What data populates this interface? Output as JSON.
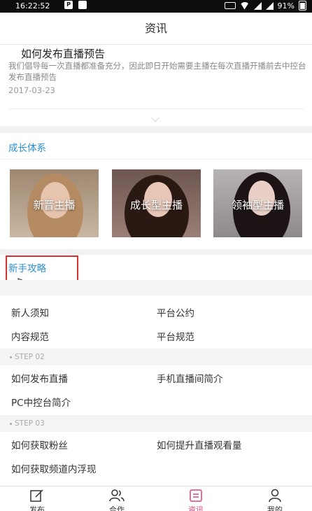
{
  "status_bar": {
    "time": "16:22:52",
    "left_icons": [
      "p-icon",
      "image-icon"
    ],
    "battery": "91%"
  },
  "header": {
    "title": "资讯"
  },
  "news": {
    "title": "如何发布直播预告",
    "desc": "我们倡导每一次直播都准备充分，因此即日开始需要主播在每次直播开播前去中控台发布直播预告",
    "date": "2017-03-23"
  },
  "growth": {
    "title": "成长体系",
    "cards": [
      {
        "label": "新晋主播"
      },
      {
        "label": "成长型主播"
      },
      {
        "label": "领袖型主播"
      }
    ]
  },
  "guide": {
    "title": "新手攻略",
    "step1_links": [
      "新人须知",
      "平台公约",
      "内容规范",
      "平台规范"
    ],
    "step2_label": "STEP  02",
    "step2_links": [
      "如何发布直播",
      "手机直播间简介",
      "PC中控台简介"
    ],
    "step3_label": "STEP  03",
    "step3_links": [
      "如何获取粉丝",
      "如何提升直播观看量",
      "如何获取频道内浮现"
    ]
  },
  "tabbar": {
    "tabs": [
      {
        "label": "发布",
        "icon": "edit-icon"
      },
      {
        "label": "合作",
        "icon": "people-icon"
      },
      {
        "label": "资讯",
        "icon": "news-icon"
      },
      {
        "label": "我的",
        "icon": "user-icon"
      }
    ],
    "active_color": "#e2417a"
  },
  "colors": {
    "accent_blue": "#2b8fd6",
    "highlight_red": "#d93030"
  }
}
